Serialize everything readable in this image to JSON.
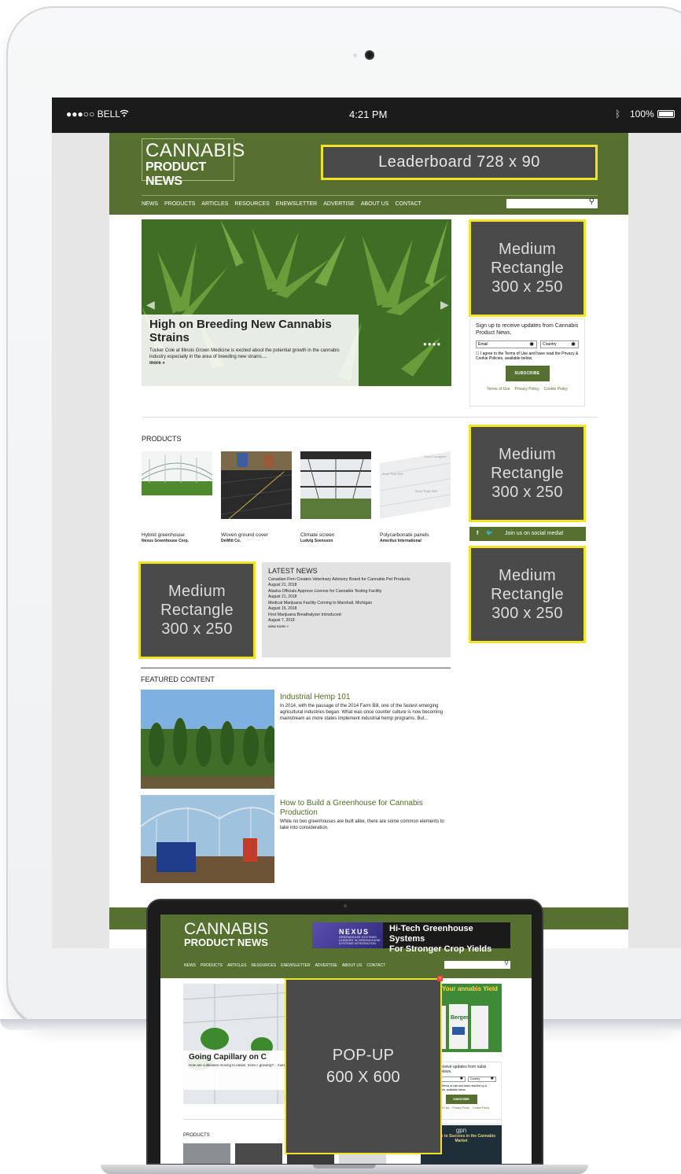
{
  "status_bar": {
    "carrier": "●●●○○ BELL",
    "time": "4:21 PM",
    "battery": "100%"
  },
  "site": {
    "logo_line1": "CANNABIS",
    "logo_line2": "PRODUCT NEWS",
    "leaderboard": "Leaderboard 728 x 90",
    "nav": [
      "NEWS",
      "PRODUCTS",
      "ARTICLES",
      "RESOURCES",
      "ENEWSLETTER",
      "ADVERTISE",
      "ABOUT US",
      "CONTACT"
    ],
    "search_placeholder": "",
    "hero": {
      "title": "High on Breeding New Cannabis Strains",
      "description": "Tucker Cole at Illinois Grown Medicine is excited about the potential growth in the cannabis industry especially in the area of breeding new strains....",
      "more": "more »"
    },
    "ad_medium_rect": [
      "Medium",
      "Rectangle",
      "300 x 250"
    ],
    "signup": {
      "heading": "Sign up to receive updates from Cannabis Product News.",
      "email_label": "Email",
      "country_label": "Country",
      "agree": "I agree to the Terms of Use and have read the Privacy & Cookie Policies, available below.",
      "button": "SUBSCRIBE",
      "links": [
        "Terms of Use",
        "Privacy Policy",
        "Cookie Policy"
      ]
    },
    "products_title": "PRODUCTS",
    "products": [
      {
        "name": "Hybrid greenhouse",
        "maker": "Nexus Greenhouse Corp."
      },
      {
        "name": "Woven ground cover",
        "maker": "DeWitt Co."
      },
      {
        "name": "Climate screen",
        "maker": "Ludvig Svensson"
      },
      {
        "name": "Polycarbonate panels",
        "maker": "Amerilux International"
      }
    ],
    "panel_labels": [
      "Gross Corrugated",
      "Stone Twin Wall",
      "Stone Triple Wall"
    ],
    "social": {
      "icons": "f  🐦",
      "text": "Join us on social media!"
    },
    "latest": {
      "title": "LATEST NEWS",
      "items": [
        {
          "headline": "Canadian Firm Creates Veterinary Advisory Board for Cannabis Pet Products",
          "date": "August 21, 2018"
        },
        {
          "headline": "Alaska Officials Approve License for Cannabis Testing Facility",
          "date": "August 21, 2018"
        },
        {
          "headline": "Medical Marijuana Facility Coming to Marshall, Michigan",
          "date": "August 15, 2018"
        },
        {
          "headline": "First Marijuana Breathalyzer Introduced",
          "date": "August 7, 2018"
        }
      ],
      "more": "view more »"
    },
    "featured_title": "FEATURED CONTENT",
    "featured": [
      {
        "title": "Industrial Hemp 101",
        "desc": "In 2014, with the passage of the 2014 Farm Bill, one of the fastest emerging agricultural industries began. What was once counter culture is now becoming mainstream as more states implement industrial hemp programs. But..."
      },
      {
        "title": "How to Build a Greenhouse for Cannabis Production",
        "desc": "While no two greenhouses are built alike, there are some common elements to take into consideration."
      }
    ]
  },
  "laptop": {
    "logo_line1": "CANNABIS",
    "logo_line2": "PRODUCT NEWS",
    "nexus_name": "NEXUS",
    "nexus_sub": "GREENHOUSE SYSTEMS",
    "nexus_tag": "LEADERS IN GREENHOUSE SYSTEMS INTEGRATION",
    "nexus_headline1": "Hi-Tech Greenhouse Systems",
    "nexus_headline2": "For Stronger Crop Yields",
    "nav": [
      "NEWS",
      "PRODUCTS",
      "ARTICLES",
      "RESOURCES",
      "ENEWSLETTER",
      "ADVERTISE",
      "ABOUT US",
      "CONTACT"
    ],
    "hero_title": "Going Capillary on C",
    "hero_desc": "How are cultivators moving to easier, more c growing?... more »",
    "ad_text": "oost Your annabis Yield",
    "ad_brand": "Berger",
    "signup_heading": "s up to receive updates from nabis Product News.",
    "email_label": "il",
    "country_label": "Country",
    "agree": "agree to the Terms of Use and have read the cy & Cookie Policies, available below.",
    "button": "SUBSCRIBE",
    "links": [
      "Terms of Use",
      "Privacy Policy",
      "Cookie Policy"
    ],
    "products_title": "PRODUCTS",
    "gpn_logo": "gpn",
    "gpn_text": "ur Guide to Success in the Cannabis Market",
    "popup_line1": "POP-UP",
    "popup_line2": "600 X 600",
    "popup_close": "x"
  }
}
